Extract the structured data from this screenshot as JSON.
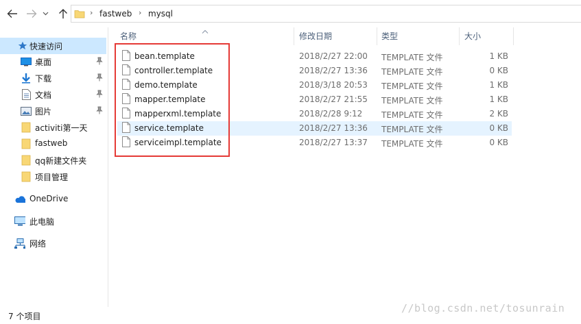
{
  "breadcrumb": [
    "fastweb",
    "mysql"
  ],
  "sidebar": {
    "quick_access": "快速访问",
    "items": [
      {
        "label": "桌面",
        "icon": "desktop-icon",
        "pinned": true
      },
      {
        "label": "下载",
        "icon": "download-icon",
        "pinned": true
      },
      {
        "label": "文档",
        "icon": "document-icon",
        "pinned": true
      },
      {
        "label": "图片",
        "icon": "picture-icon",
        "pinned": true
      },
      {
        "label": "activiti第一天",
        "icon": "folder-icon",
        "pinned": false
      },
      {
        "label": "fastweb",
        "icon": "folder-icon",
        "pinned": false
      },
      {
        "label": "qq新建文件夹",
        "icon": "folder-icon",
        "pinned": false
      },
      {
        "label": "项目管理",
        "icon": "folder-icon",
        "pinned": false
      }
    ],
    "onedrive": "OneDrive",
    "this_pc": "此电脑",
    "network": "网络"
  },
  "columns": {
    "name": "名称",
    "modified": "修改日期",
    "type": "类型",
    "size": "大小"
  },
  "files": [
    {
      "name": "bean.template",
      "modified": "2018/2/27 22:00",
      "type": "TEMPLATE 文件",
      "size": "1 KB"
    },
    {
      "name": "controller.template",
      "modified": "2018/2/27 13:36",
      "type": "TEMPLATE 文件",
      "size": "0 KB"
    },
    {
      "name": "demo.template",
      "modified": "2018/3/18 20:53",
      "type": "TEMPLATE 文件",
      "size": "1 KB"
    },
    {
      "name": "mapper.template",
      "modified": "2018/2/27 21:55",
      "type": "TEMPLATE 文件",
      "size": "1 KB"
    },
    {
      "name": "mapperxml.template",
      "modified": "2018/2/28 9:12",
      "type": "TEMPLATE 文件",
      "size": "2 KB"
    },
    {
      "name": "service.template",
      "modified": "2018/2/27 13:36",
      "type": "TEMPLATE 文件",
      "size": "0 KB"
    },
    {
      "name": "serviceimpl.template",
      "modified": "2018/2/27 13:37",
      "type": "TEMPLATE 文件",
      "size": "0 KB"
    }
  ],
  "status": {
    "item_count": "7 个项目"
  },
  "watermark": "//blog.csdn.net/tosunrain",
  "colors": {
    "highlight_border": "#e53935",
    "selected_row": "#e5f3ff",
    "selected_nav": "#cce8ff",
    "folder_yellow": "#f8d775",
    "header_text": "#4c607a"
  }
}
